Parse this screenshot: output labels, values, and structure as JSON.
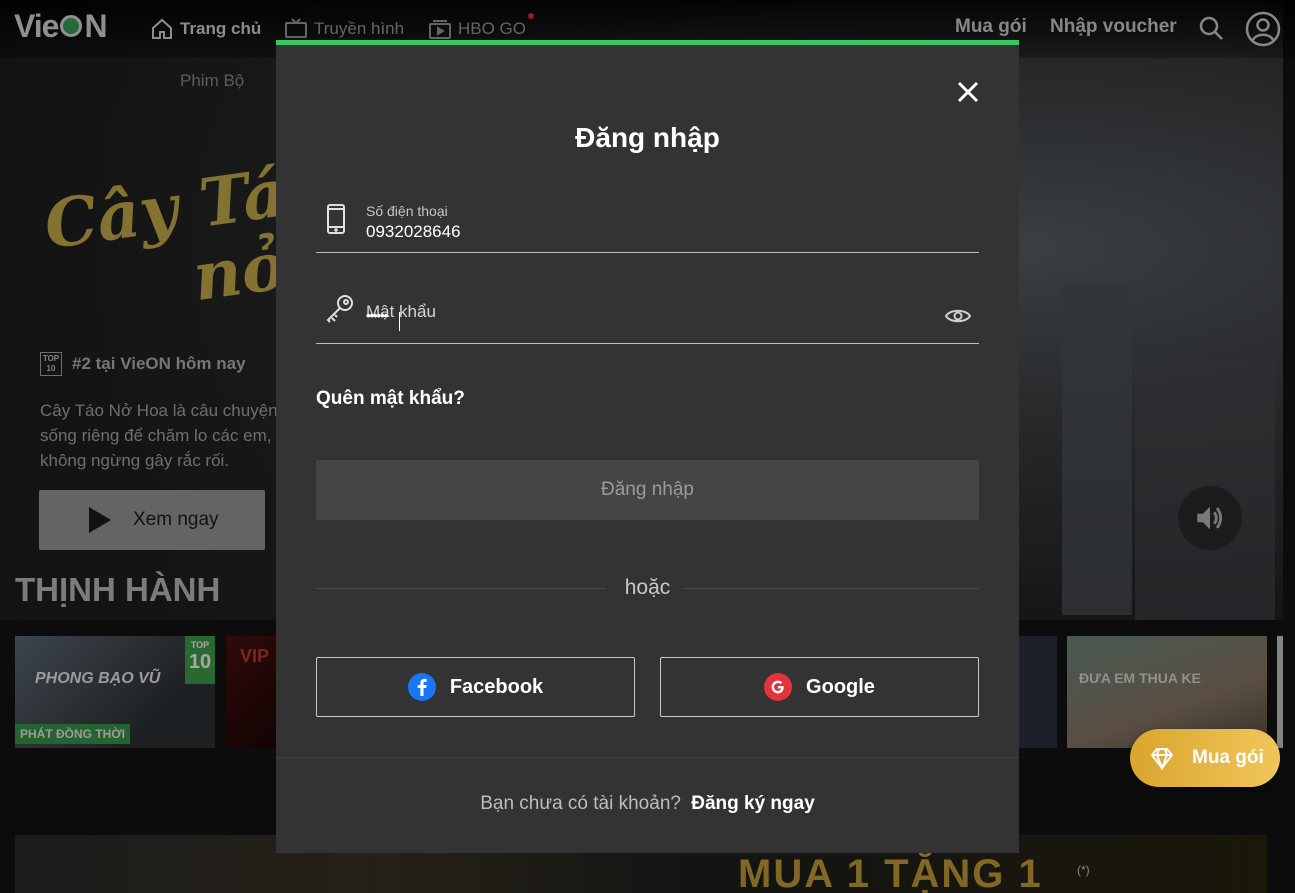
{
  "header": {
    "logo": "VieON",
    "nav": [
      {
        "label": "Trang chủ",
        "icon": "home-icon"
      },
      {
        "label": "Truyền hình",
        "icon": "tv-icon"
      },
      {
        "label": "HBO GO",
        "icon": "video-icon"
      }
    ],
    "buy_label": "Mua gói",
    "voucher_label": "Nhập voucher",
    "subnav_item": "Phim Bộ"
  },
  "hero": {
    "title_line1": "Cây Táo",
    "title_line2": "nở",
    "rank_text": "#2 tại VieON hôm nay",
    "rank_badge": "TOP 10",
    "description": "Cây Táo Nở Hoa là câu chuyện sống riêng để chăm lo các em, không ngừng gây rắc rối.",
    "watch_label": "Xem ngay"
  },
  "trending": {
    "title": "THỊNH HÀNH",
    "items": [
      {
        "title": "PHONG BẠO VŨ",
        "badge_top": "TOP",
        "badge_num": "10",
        "tag": "PHÁT ĐỒNG THỜI"
      },
      {
        "title": "VIP"
      },
      {
        "title": ""
      },
      {
        "title": "ĐƯA EM THUA KE"
      }
    ]
  },
  "banner_text": "MUA 1 TẶNG 1",
  "banner_note": "(*)",
  "floating_buy_label": "Mua gói",
  "login_modal": {
    "title": "Đăng nhập",
    "phone_label": "Số điện thoại",
    "phone_value": "0932028646",
    "password_label": "Mật khẩu",
    "password_mask": "••••••",
    "forgot_label": "Quên mật khẩu?",
    "submit_label": "Đăng nhập",
    "or_label": "hoặc",
    "facebook_label": "Facebook",
    "google_label": "Google",
    "no_account_text": "Bạn chưa có tài khoản?",
    "signup_label": "Đăng ký ngay"
  },
  "colors": {
    "accent_green": "#3ac664",
    "modal_bg": "#333333",
    "gold": "#e0b446",
    "facebook_blue": "#1877f2",
    "google_red": "#e4323f"
  }
}
